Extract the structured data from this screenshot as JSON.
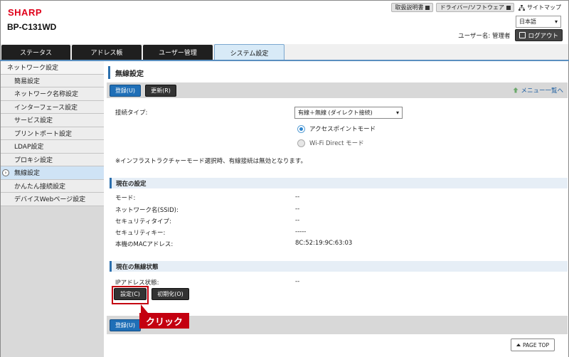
{
  "brand": {
    "logo": "SHARP",
    "model": "BP-C131WD"
  },
  "toplinks": {
    "manual": "取扱説明書",
    "driver": "ドライバー/ソフトウェア",
    "sitemap": "サイトマップ"
  },
  "language": {
    "selected": "日本語"
  },
  "user": {
    "label": "ユーザー名: 管理者",
    "logout": "ログアウト"
  },
  "tabs": [
    {
      "label": "ステータス",
      "active": false
    },
    {
      "label": "アドレス帳",
      "active": false
    },
    {
      "label": "ユーザー管理",
      "active": false
    },
    {
      "label": "システム設定",
      "active": true
    }
  ],
  "sidebar": {
    "items": [
      {
        "label": "ネットワーク設定",
        "type": "head"
      },
      {
        "label": "簡易設定"
      },
      {
        "label": "ネットワーク名称設定"
      },
      {
        "label": "インターフェース設定"
      },
      {
        "label": "サービス設定"
      },
      {
        "label": "プリントポート設定"
      },
      {
        "label": "LDAP設定"
      },
      {
        "label": "プロキシ設定"
      },
      {
        "label": "無線設定",
        "active": true
      },
      {
        "label": "かんたん接続設定"
      },
      {
        "label": "デバイスWebページ設定"
      }
    ]
  },
  "main": {
    "title": "無線設定",
    "register_btn": "登録(U)",
    "update_btn": "更新(R)",
    "menu_back": "メニュー一覧へ",
    "connection_type_label": "接続タイプ:",
    "connection_type_value": "有線＋無線 (ダイレクト接続)",
    "radio_ap": "アクセスポイントモード",
    "radio_wifi_direct": "Wi-Fi Direct モード",
    "note": "※インフラストラクチャーモード選択時、有線接続は無効となります。",
    "current_settings": {
      "title": "現在の設定",
      "rows": [
        {
          "label": "モード:",
          "value": "--"
        },
        {
          "label": "ネットワーク名(SSID):",
          "value": "--"
        },
        {
          "label": "セキュリティタイプ:",
          "value": "--"
        },
        {
          "label": "セキュリティキー:",
          "value": "-----"
        },
        {
          "label": "本機のMACアドレス:",
          "value": "8C:52:19:9C:63:03"
        }
      ]
    },
    "wireless_status": {
      "title": "現在の無線状態",
      "ip_label": "IPアドレス状態:",
      "ip_value": "--",
      "setting_btn": "設定(C)",
      "init_btn": "初期化(O)"
    },
    "bottom_register_btn": "登録(U)",
    "page_top": "PAGE TOP"
  },
  "annotation": {
    "callout": "クリック"
  },
  "colors": {
    "accent": "#1f6fb7",
    "brand_red": "#e0001a",
    "callout": "#c40010"
  }
}
